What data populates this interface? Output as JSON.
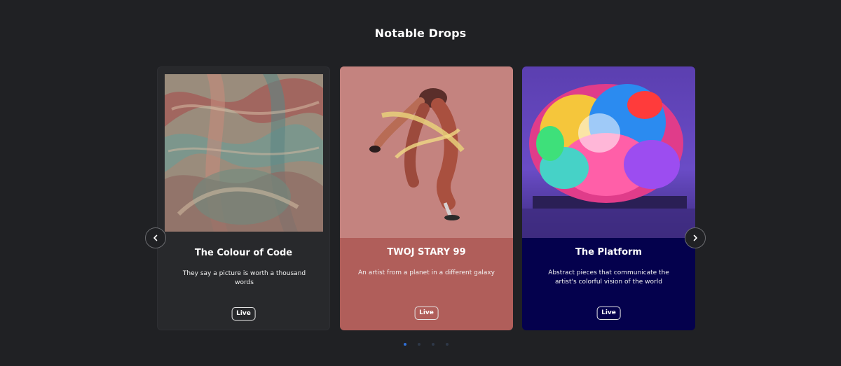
{
  "section": {
    "title": "Notable Drops"
  },
  "cards": [
    {
      "title": "The Colour of Code",
      "description": "They say a picture is worth a thousand words",
      "badge": "Live",
      "image": "abstract-marbled-artwork"
    },
    {
      "title": "TWOJ STARY 99",
      "description": "An artist from a planet in a different galaxy",
      "badge": "Live",
      "image": "jumping-figure-artwork"
    },
    {
      "title": "The Platform",
      "description": "Abstract pieces that communicate the artist's colorful vision of the world",
      "badge": "Live",
      "image": "colorful-sculpture-artwork"
    }
  ],
  "carousel": {
    "prev_icon": "chevron-left-icon",
    "next_icon": "chevron-right-icon",
    "dot_count": 4,
    "active_dot": 0
  },
  "colors": {
    "background": "#202124",
    "card_1": "#28292c",
    "card_2": "#b05e5a",
    "card_3": "#04014d",
    "active_dot": "#2f6fd6"
  }
}
